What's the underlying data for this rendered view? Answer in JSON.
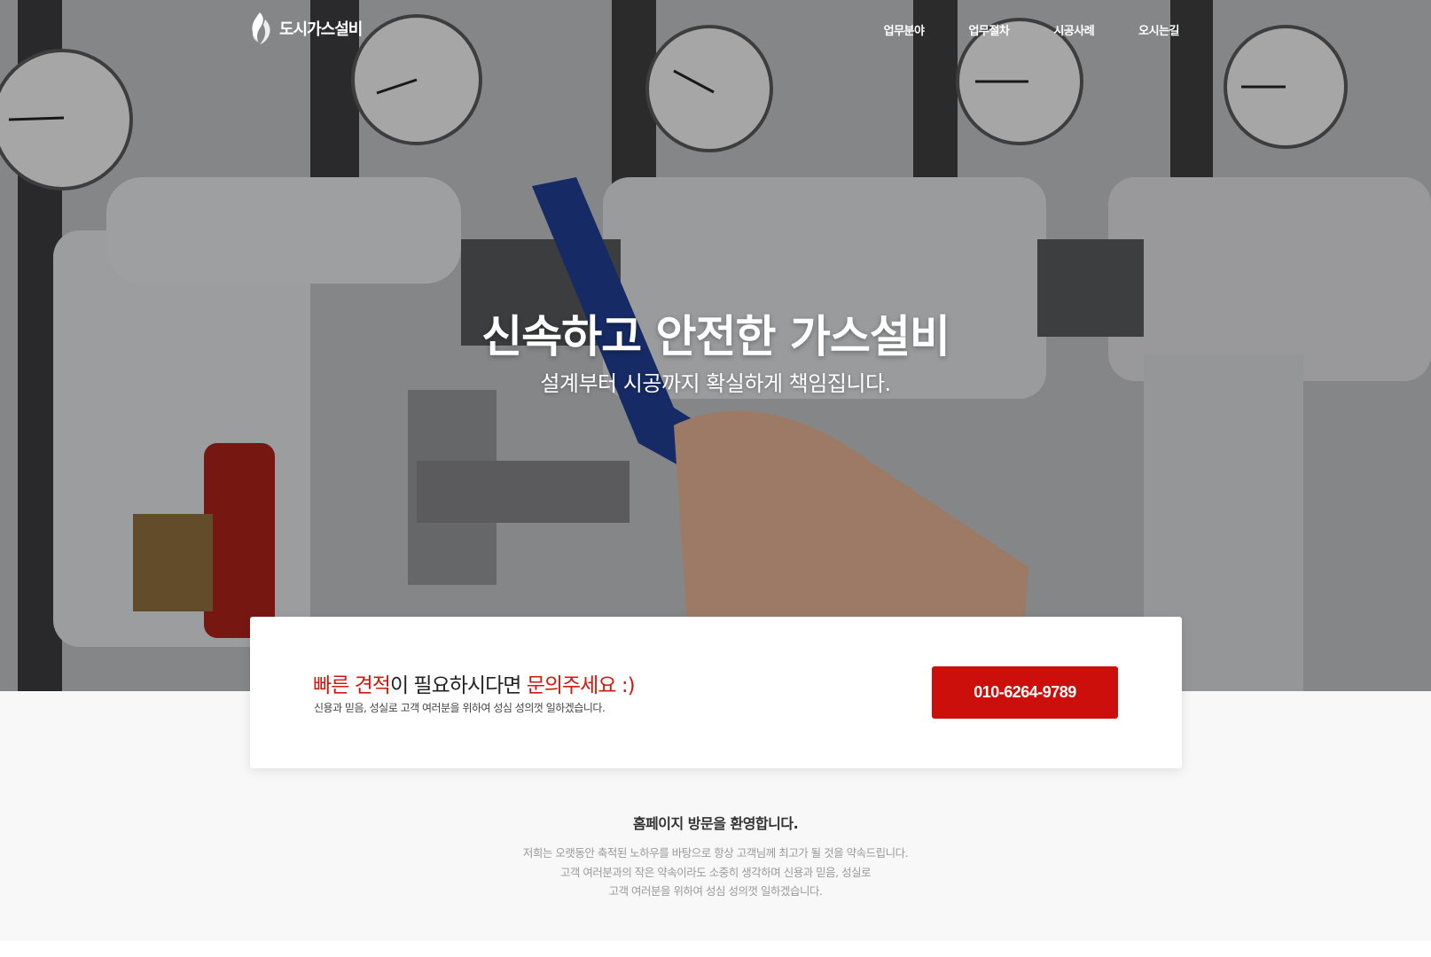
{
  "header": {
    "logo_text": "도시가스설비",
    "logo_icon": "flame-icon",
    "nav": [
      {
        "label": "업무분야"
      },
      {
        "label": "업무절차"
      },
      {
        "label": "시공사례"
      },
      {
        "label": "오시는길"
      }
    ]
  },
  "hero": {
    "title": "신속하고 안전한 가스설비",
    "subtitle": "설계부터 시공까지 확실하게 책임집니다."
  },
  "cta": {
    "heading_part1": "빠른 견적",
    "heading_part2": "이 필요하시다면 ",
    "heading_part3": "문의주세요 :)",
    "description": "신용과 믿음, 성실로 고객 여러분을 위하여 성심 성의껏 일하겠습니다.",
    "phone": "010-6264-9789"
  },
  "welcome": {
    "title": "홈페이지 방문을 환영합니다.",
    "lines": [
      "저희는 오랫동안 축적된 노하우를 바탕으로 항상 고객님께 최고가 될 것을 약속드립니다.",
      "고객 여러분과의 작은 약속이라도 소중히 생각하며 신용과 믿음, 성실로",
      "고객 여러분을 위하여 성심 성의껏 일하겠습니다."
    ]
  },
  "colors": {
    "accent_red": "#cc1a10",
    "button_red": "#cc0f0a"
  }
}
